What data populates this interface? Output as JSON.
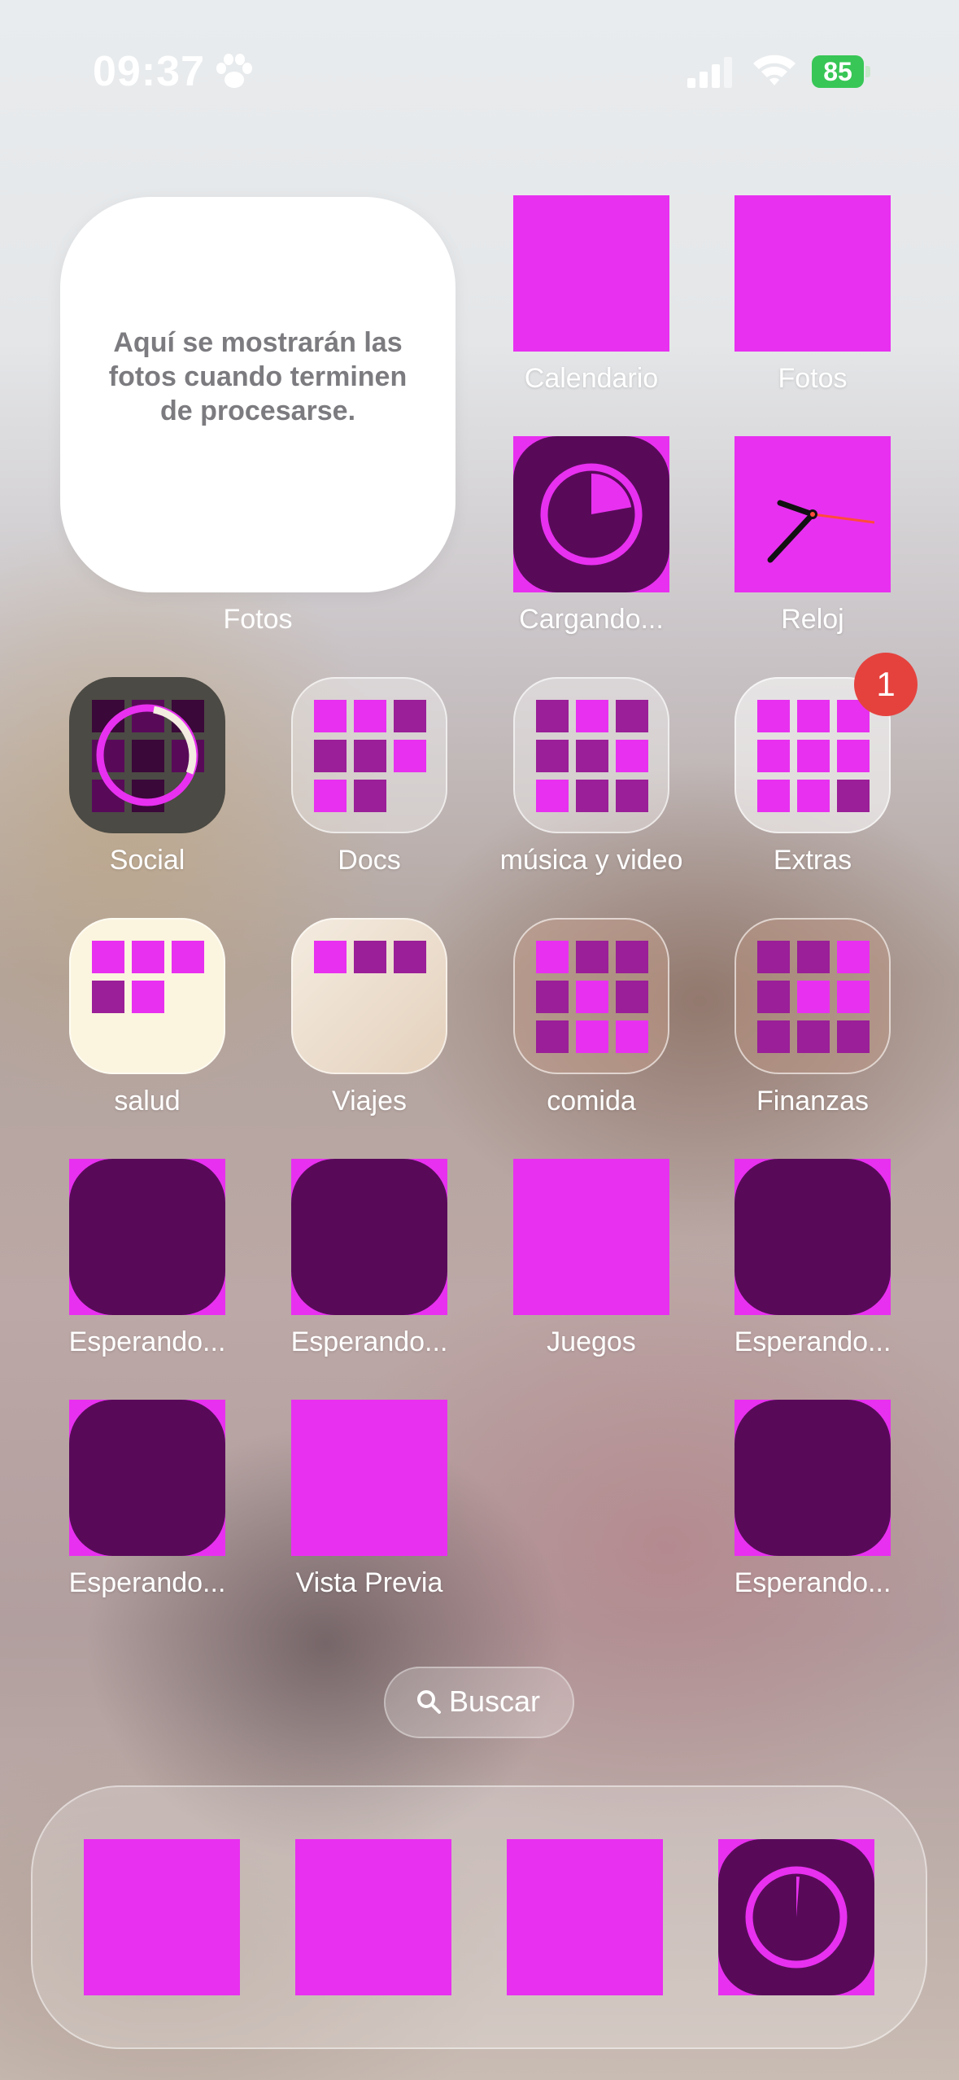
{
  "status_bar": {
    "time": "09:37",
    "battery": "85",
    "icons": [
      "paw-icon",
      "cellular-signal-icon",
      "wifi-icon",
      "battery-charging-icon"
    ]
  },
  "photos_widget": {
    "message": "Aquí se mostrarán las fotos cuando terminen de procesarse.",
    "label": "Fotos"
  },
  "apps": {
    "calendario": "Calendario",
    "fotos": "Fotos",
    "cargando": "Cargando...",
    "reloj": "Reloj",
    "social": "Social",
    "docs": "Docs",
    "musica": "música y video",
    "extras": "Extras",
    "salud": "salud",
    "viajes": "Viajes",
    "comida": "comida",
    "finanzas": "Finanzas",
    "esperando1": "Esperando...",
    "esperando2": "Esperando...",
    "juegos": "Juegos",
    "esperando3": "Esperando...",
    "esperando4": "Esperando...",
    "vista_previa": "Vista Previa",
    "esperando5": "Esperando..."
  },
  "badges": {
    "extras": "1"
  },
  "search": {
    "label": "Buscar"
  },
  "colors": {
    "placeholder_magenta": "#e830f0",
    "waiting_purple": "#580a59",
    "folder_dark_cell": "#9a1f98",
    "badge_red": "#e5423e"
  }
}
